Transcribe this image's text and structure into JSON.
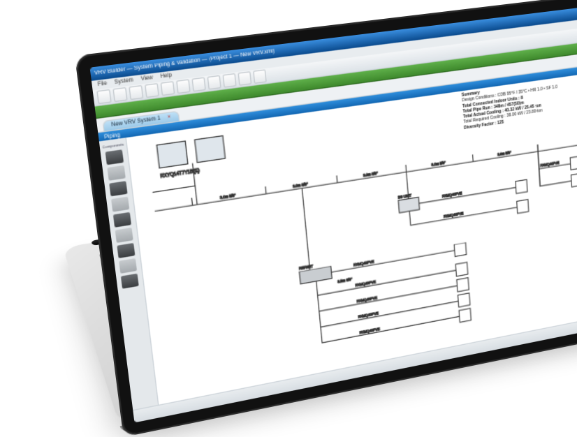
{
  "window": {
    "title": "VRV Builder — System Piping & Validation — (Project 1 — New VRV.xml)",
    "btn_min": "—",
    "btn_max": "▢",
    "btn_close": "✕"
  },
  "menu": {
    "items": [
      "File",
      "System",
      "View",
      "Help"
    ]
  },
  "tabstrip": {
    "label": "New VRV System 1",
    "close": "×"
  },
  "doc_header": {
    "left": "Piping",
    "right_icons": [
      "⤢",
      "✕"
    ]
  },
  "palette_hdr": "Components",
  "summary": {
    "heading": "Summary",
    "lines": [
      "Design Conditions :  CDB 95°F / 35°C • HR 1.0 • SF 1.0",
      "Total Connected Indoor Units : 8",
      "Total Pipe Run :  348m / 457(50)m",
      "Total Actual Cooling :  40.32 kW / 25.45 ton",
      "Total Required Cooling :  38.00 kW / 23.80 ton",
      "Diversity Factor :  125"
    ]
  },
  "canvas": {
    "outdoor_label": "RXYQ14T7Y1B(E)",
    "node_text": "REFNET",
    "bs_text": "BS UNIT",
    "idu_label": "FXMQ40PVE",
    "dim1": "3.0m  5/8\"",
    "dim2": "3.5m  3/8\""
  }
}
